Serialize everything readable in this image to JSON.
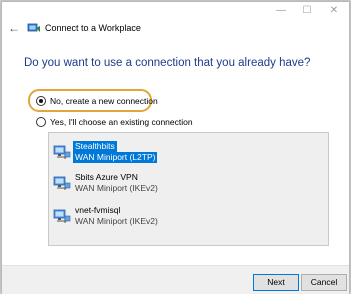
{
  "window": {
    "title": "Connect to a Workplace",
    "controls": {
      "minimize": "—",
      "maximize": "☐",
      "close": "✕"
    },
    "back": "←"
  },
  "heading": "Do you want to use a connection that you already have?",
  "options": [
    {
      "label": "No, create a new connection",
      "checked": true
    },
    {
      "label": "Yes, I'll choose an existing connection",
      "checked": false
    }
  ],
  "connections": [
    {
      "name": "Stealthbits",
      "type": "WAN Miniport (L2TP)",
      "selected": true,
      "icon": "network-connection-icon"
    },
    {
      "name": "Sbits Azure VPN",
      "type": "WAN Miniport (IKEv2)",
      "selected": false,
      "icon": "network-connection-icon"
    },
    {
      "name": "vnet-fvmisql",
      "type": "WAN Miniport (IKEv2)",
      "selected": false,
      "icon": "network-connection-icon"
    }
  ],
  "buttons": {
    "next": "Next",
    "cancel": "Cancel"
  },
  "colors": {
    "heading": "#1c3c8a",
    "selection": "#0078d7",
    "highlight_ring": "#e3a53c"
  }
}
